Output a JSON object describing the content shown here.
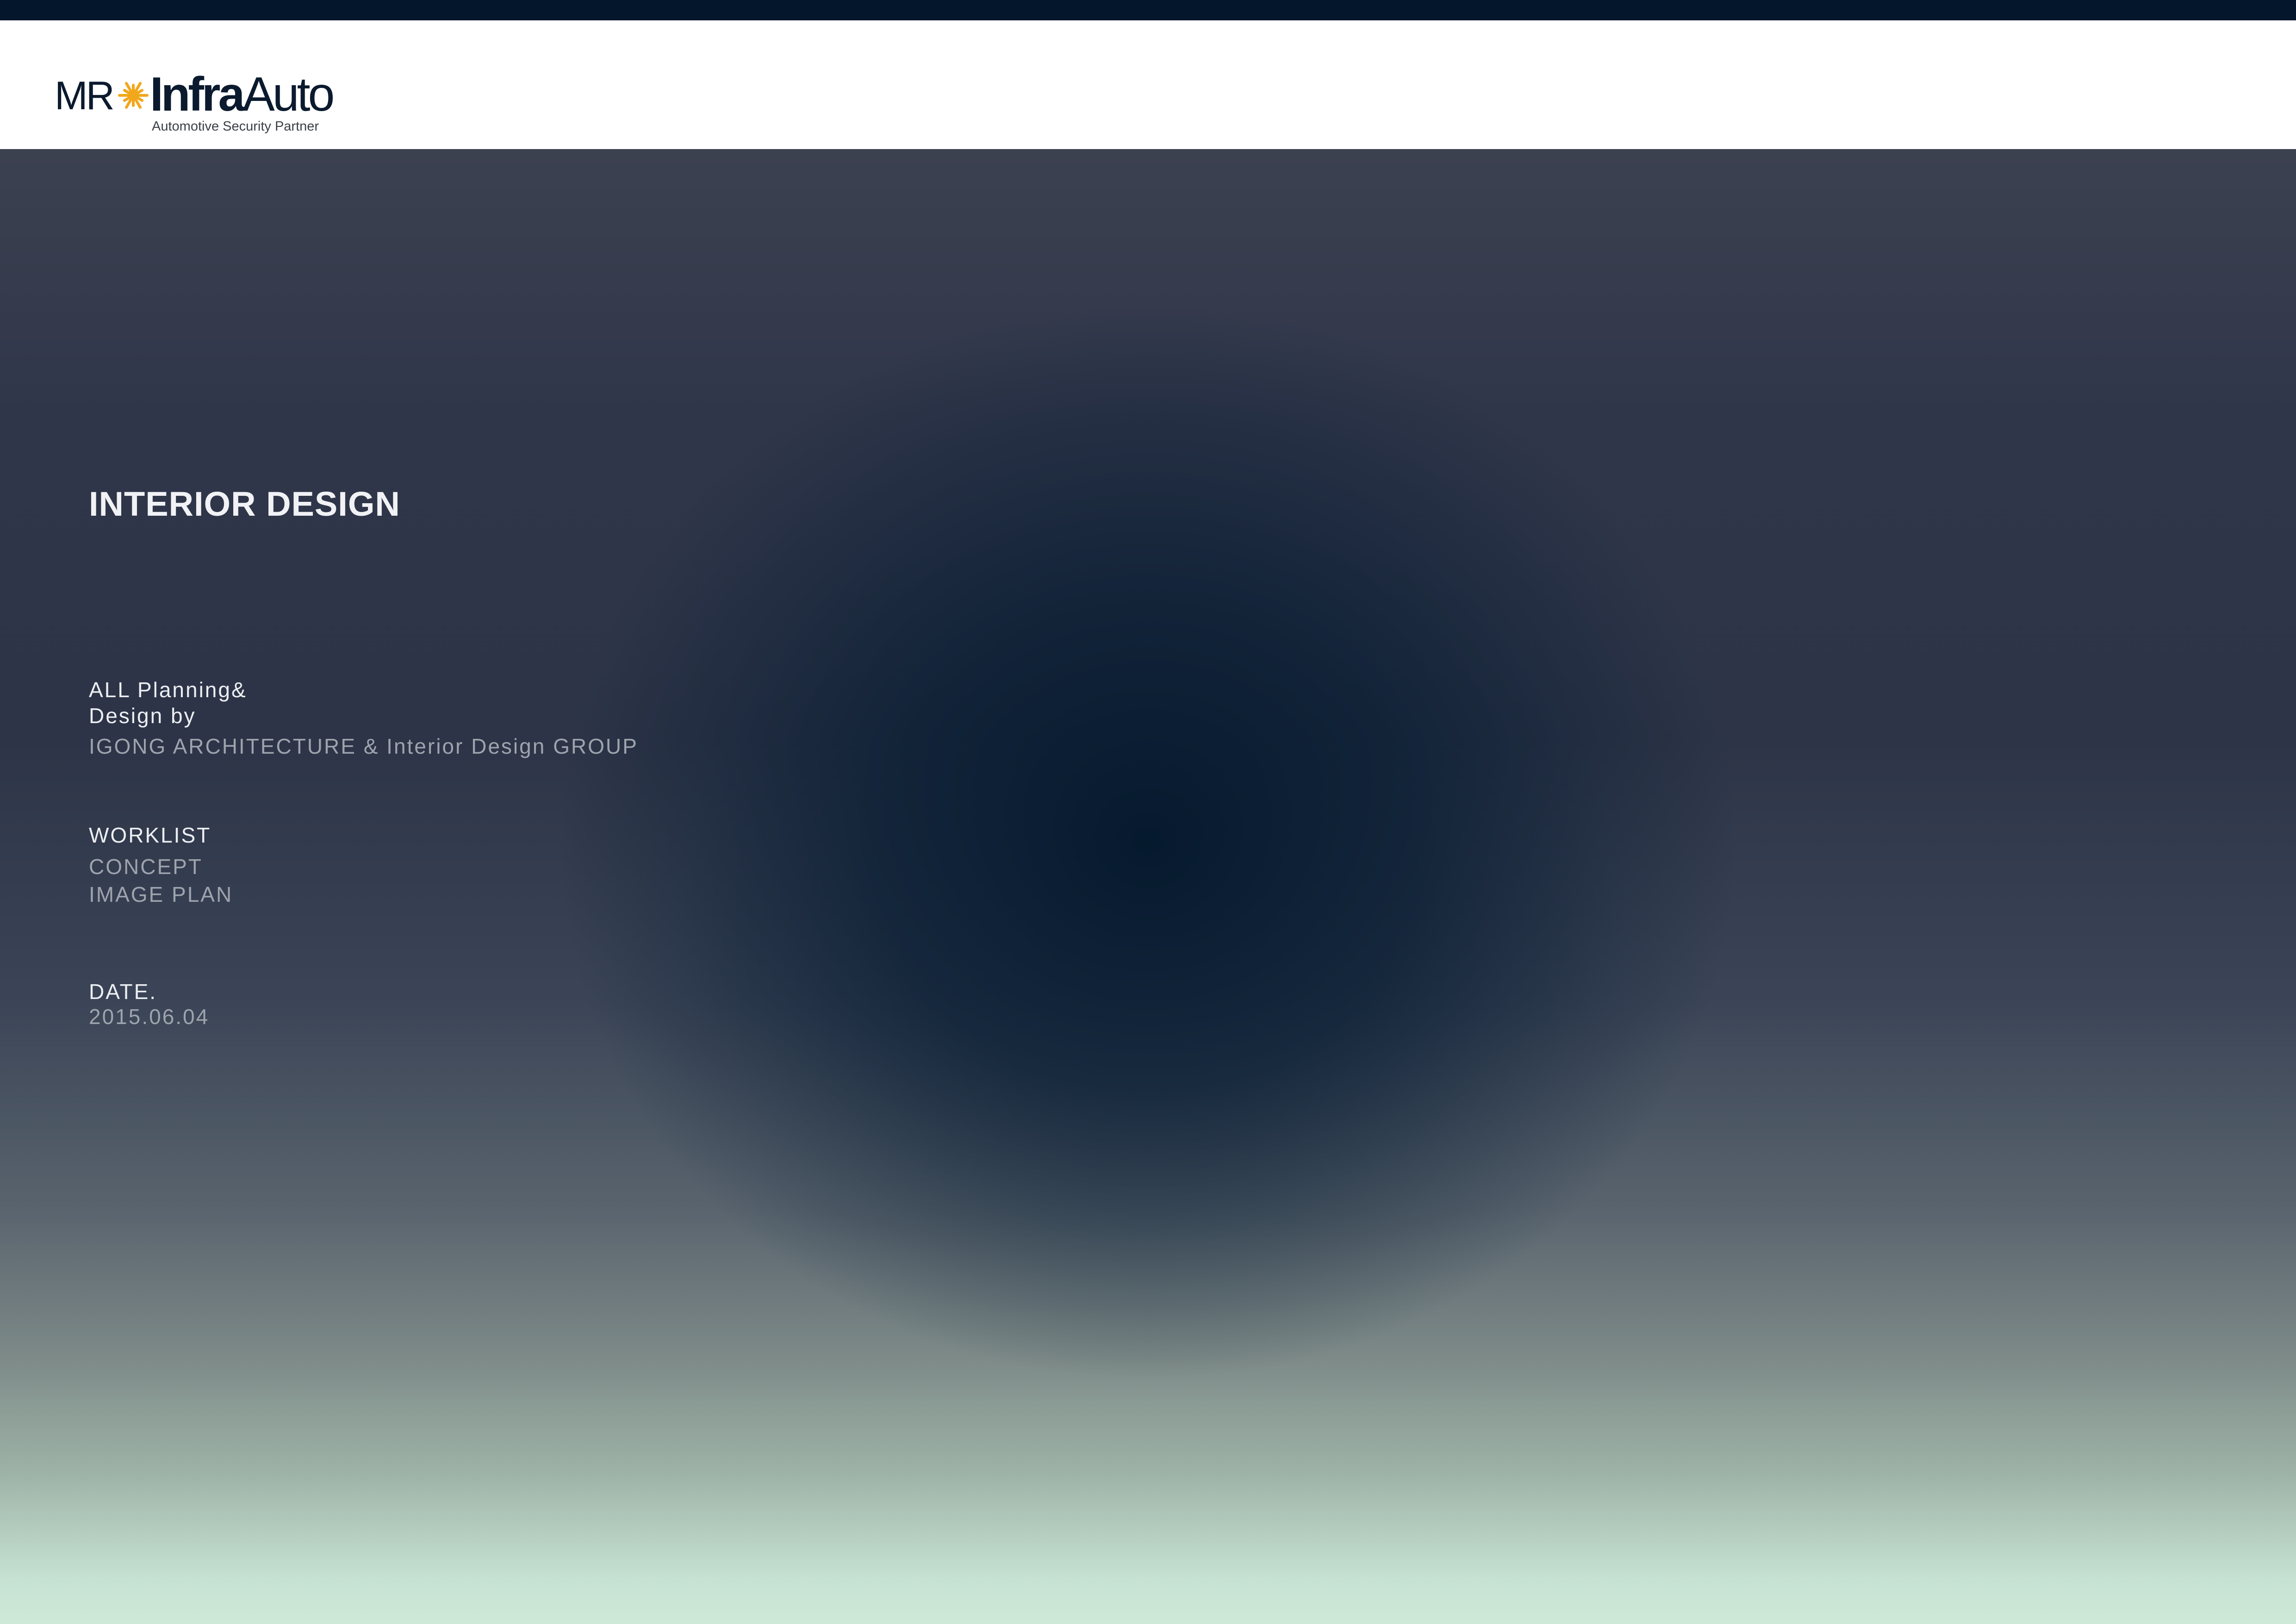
{
  "header": {
    "logo": {
      "prefix": "MR",
      "brand_bold": "Infra",
      "brand_light": "Auto",
      "tagline": "Automotive Security Partner",
      "star_icon": "star-burst-icon",
      "star_color": "#f2a71b"
    }
  },
  "colors": {
    "top_bar": "#03162b",
    "hero_top": "#3c4150",
    "hero_center": "#04182d",
    "hero_bottom": "#cfe9d8"
  },
  "cover": {
    "title": "INTERIOR DESIGN",
    "planning_label_line1": "ALL Planning&",
    "planning_label_line2": "Design by",
    "planning_value": "IGONG ARCHITECTURE & Interior Design GROUP",
    "worklist_label": "WORKLIST",
    "worklist_items": [
      "CONCEPT",
      "IMAGE PLAN"
    ],
    "date_label": "DATE.",
    "date_value": "2015.06.04"
  }
}
